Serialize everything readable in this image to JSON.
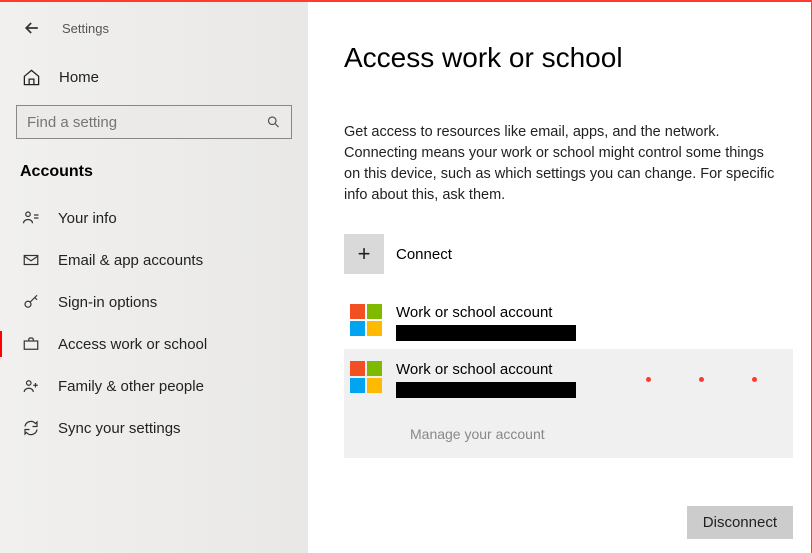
{
  "titlebar": {
    "title": "Settings"
  },
  "home_label": "Home",
  "search": {
    "placeholder": "Find a setting"
  },
  "section_header": "Accounts",
  "nav": [
    {
      "id": "your-info",
      "label": "Your info"
    },
    {
      "id": "email-accounts",
      "label": "Email & app accounts"
    },
    {
      "id": "signin-options",
      "label": "Sign-in options"
    },
    {
      "id": "access-work-school",
      "label": "Access work or school"
    },
    {
      "id": "family-people",
      "label": "Family & other people"
    },
    {
      "id": "sync-settings",
      "label": "Sync your settings"
    }
  ],
  "page": {
    "title": "Access work or school",
    "description": "Get access to resources like email, apps, and the network. Connecting means your work or school might control some things on this device, such as which settings you can change. For specific info about this, ask them.",
    "connect_label": "Connect",
    "accounts": [
      {
        "title": "Work or school account",
        "redacted": true,
        "selected": false
      },
      {
        "title": "Work or school account",
        "redacted": true,
        "selected": true
      }
    ],
    "manage_label": "Manage your account",
    "disconnect_label": "Disconnect"
  }
}
